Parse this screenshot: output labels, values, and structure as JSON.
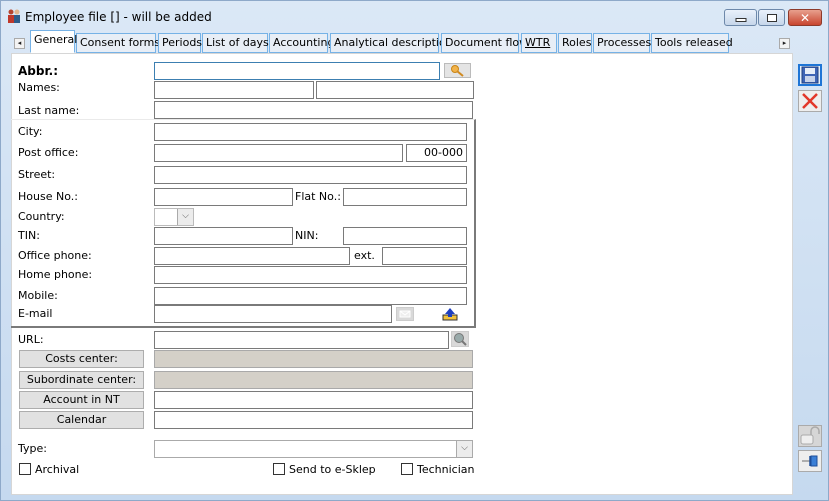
{
  "window": {
    "title": "Employee file [] - will be added",
    "icon": "employee-icon",
    "controls": {
      "minimize": "minimize-icon",
      "maximize": "maximize-icon",
      "close": "close-icon"
    }
  },
  "tabs": {
    "scroll_left": "◂",
    "scroll_right": "▸",
    "items": [
      {
        "label": "General",
        "active": true
      },
      {
        "label": "Consent forms"
      },
      {
        "label": "Periods"
      },
      {
        "label": "List of days"
      },
      {
        "label": "Accounting"
      },
      {
        "label": "Analytical description"
      },
      {
        "label": "Document flow"
      },
      {
        "label": "WTR"
      },
      {
        "label": "Roles"
      },
      {
        "label": "Processes"
      },
      {
        "label": "Tools released"
      }
    ]
  },
  "form": {
    "abbr_label": "Abbr.:",
    "abbr_value": "",
    "names_label": "Names:",
    "first_name_value": "",
    "second_name_value": "",
    "last_name_label": "Last name:",
    "last_name_value": "",
    "city_label": "City:",
    "city_value": "",
    "post_office_label": "Post office:",
    "post_office_value": "",
    "postal_code_value": "00-000",
    "street_label": "Street:",
    "street_value": "",
    "house_no_label": "House No.:",
    "house_no_value": "",
    "flat_no_label": "Flat No.:",
    "flat_no_value": "",
    "country_label": "Country:",
    "country_value": "",
    "tin_label": "TIN:",
    "tin_value": "",
    "nin_label": "NIN:",
    "nin_value": "",
    "office_phone_label": "Office phone:",
    "office_phone_value": "",
    "ext_label": "ext.",
    "ext_value": "",
    "home_phone_label": "Home phone:",
    "home_phone_value": "",
    "mobile_label": "Mobile:",
    "mobile_value": "",
    "email_label": "E-mail",
    "email_value": "",
    "url_label": "URL:",
    "url_value": "",
    "costs_center_button": "Costs center:",
    "costs_center_value": "",
    "subordinate_center_button": "Subordinate center:",
    "subordinate_center_value": "",
    "nt_account_button": "Account in NT domain:",
    "nt_account_value": "",
    "calendar_button": "Calendar",
    "calendar_value": "",
    "type_label": "Type:",
    "type_value": "",
    "archival_label": "Archival",
    "archival_checked": false,
    "eshop_label": "Send to e-Sklep",
    "eshop_checked": false,
    "technician_label": "Technician",
    "technician_checked": false
  },
  "sidebar": {
    "save": "save-icon",
    "cancel": "cancel-icon",
    "lock": "unlock-icon",
    "pin": "pin-icon"
  }
}
